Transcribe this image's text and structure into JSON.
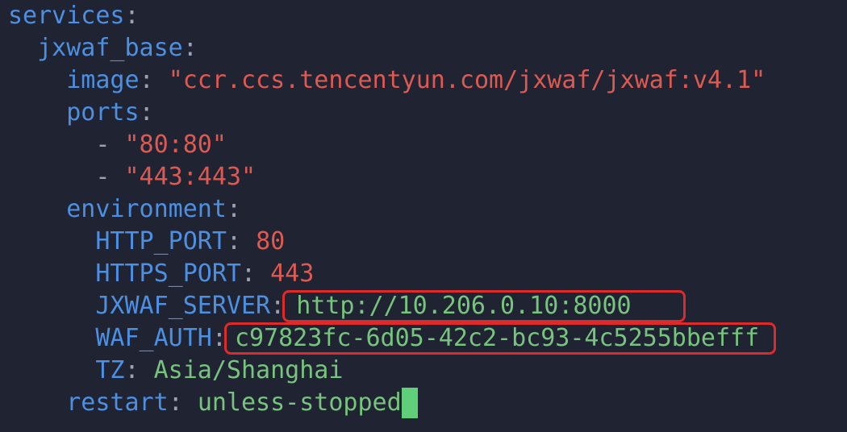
{
  "editor": {
    "lines": {
      "services_key": "services",
      "service_name": "jxwaf_base",
      "image_key": "image",
      "image_value": "\"ccr.ccs.tencentyun.com/jxwaf/jxwaf:v4.1\"",
      "ports_key": "ports",
      "port_1": "\"80:80\"",
      "port_2": "\"443:443\"",
      "environment_key": "environment",
      "http_port_key": "HTTP_PORT",
      "http_port_value": "80",
      "https_port_key": "HTTPS_PORT",
      "https_port_value": "443",
      "jxwaf_server_key": "JXWAF_SERVER",
      "jxwaf_server_value": "http://10.206.0.10:8000",
      "waf_auth_key": "WAF_AUTH",
      "waf_auth_value": "c97823fc-6d05-42c2-bc93-4c5255bbefff",
      "tz_key": "TZ",
      "tz_value": "Asia/Shanghai",
      "restart_key": "restart",
      "restart_value": "unless-stopped"
    },
    "syntax": {
      "colon": ":",
      "dash": "-"
    },
    "colors": {
      "background": "#1f2332",
      "key": "#4d8fe0",
      "string": "#dd5a52",
      "value": "#78c47e",
      "highlight_box": "#dd2a2a",
      "cursor": "#5fcf79"
    }
  }
}
